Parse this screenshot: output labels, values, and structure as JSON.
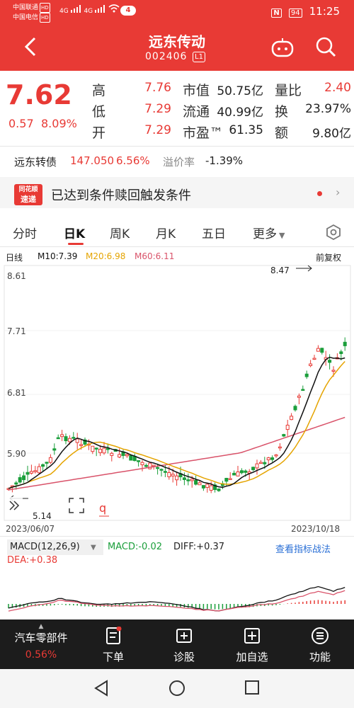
{
  "status": {
    "carrier1": "中国联通",
    "carrier2": "中国电信",
    "hd": "HD",
    "net1": "4G",
    "net2": "4G",
    "notif_count": "4",
    "nfc": "N",
    "battery": "94",
    "time": "11:25"
  },
  "header": {
    "title": "远东传动",
    "code": "002406",
    "level": "L1"
  },
  "quote": {
    "price": "7.62",
    "change": "0.57",
    "change_pct": "8.09%",
    "rows": [
      {
        "l1": "高",
        "v1": "7.76",
        "l2": "市值",
        "v2": "50.75亿",
        "l3": "量比",
        "v3": "2.40"
      },
      {
        "l1": "低",
        "v1": "7.29",
        "l2": "流通",
        "v2": "40.99亿",
        "l3": "换",
        "v3": "23.97%"
      },
      {
        "l1": "开",
        "v1": "7.29",
        "l2": "市盈™",
        "v2": "61.35",
        "l3": "额",
        "v3": "9.80亿"
      }
    ]
  },
  "bond": {
    "name": "远东转债",
    "price": "147.050",
    "pct": "6.56%",
    "premium_label": "溢价率",
    "premium": "-1.39%"
  },
  "notice": {
    "logo_line1": "同花顺",
    "logo_line2": "速递",
    "text": "已达到条件赎回触发条件"
  },
  "tabs": [
    "分时",
    "日K",
    "周K",
    "月K",
    "五日",
    "更多"
  ],
  "ma": {
    "label": "日线",
    "m10": "M10:7.39",
    "m20": "M20:6.98",
    "m60": "M60:6.11",
    "adjust": "前复权"
  },
  "price_axis": [
    "8.61",
    "7.71",
    "6.81",
    "5.90"
  ],
  "annotations": {
    "high": "8.47",
    "low": "5.14",
    "q": "q"
  },
  "dates": {
    "start": "2023/06/07",
    "end": "2023/10/18"
  },
  "macd": {
    "label": "MACD(12,26,9)",
    "macd": "MACD:-0.02",
    "diff": "DIFF:+0.37",
    "dea": "DEA:+0.38",
    "link": "查看指标战法"
  },
  "bottom_nav": {
    "sector": "汽车零部件",
    "sector_pct": "0.56%",
    "items": [
      "下单",
      "诊股",
      "加自选",
      "功能"
    ]
  },
  "colors": {
    "up": "#e83a35",
    "down": "#1a9e3a",
    "m10": "#111111",
    "m20": "#e5a400",
    "m60": "#d9536a"
  }
}
